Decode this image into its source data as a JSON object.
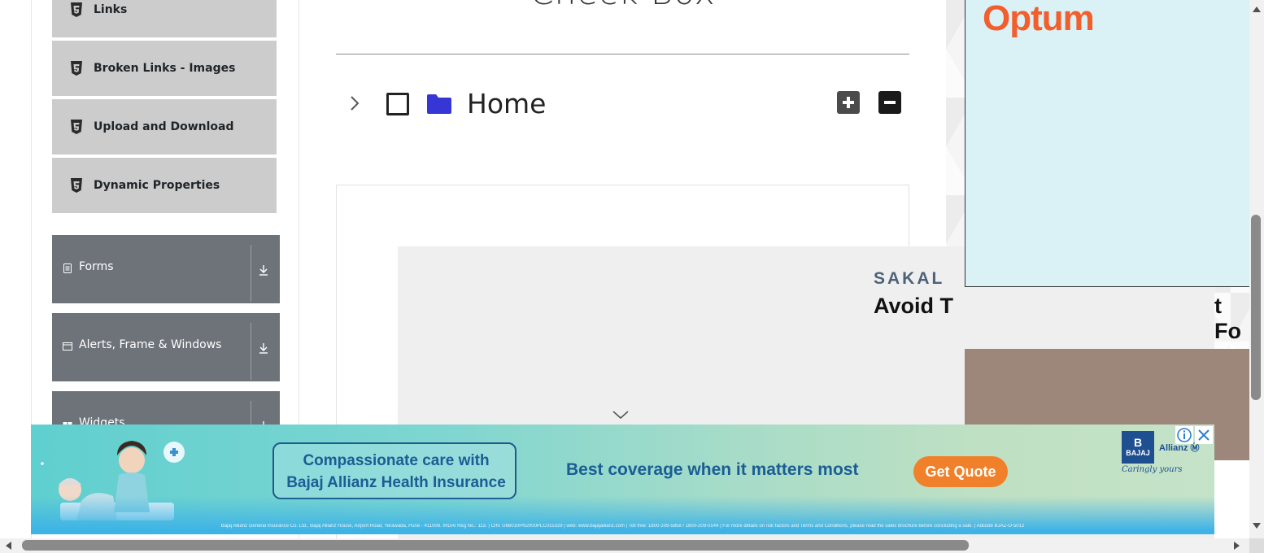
{
  "sidebar": {
    "elements_items": [
      {
        "label": "Links",
        "icon": "html5-icon"
      },
      {
        "label": "Broken Links - Images",
        "icon": "html5-icon"
      },
      {
        "label": "Upload and Download",
        "icon": "html5-icon"
      },
      {
        "label": "Dynamic Properties",
        "icon": "html5-icon"
      }
    ],
    "groups": [
      {
        "label": "Forms",
        "icon": "document-icon"
      },
      {
        "label": "Alerts, Frame & Windows",
        "icon": "window-icon"
      },
      {
        "label": "Widgets",
        "icon": "widgets-icon"
      }
    ]
  },
  "main": {
    "title": "Check Box",
    "tree": {
      "root_label": "Home",
      "expand_all_icon": "plus-square-icon",
      "collapse_all_icon": "minus-square-icon"
    }
  },
  "inner_ad": {
    "publisher": "SAKAL",
    "headline_left": "Avoid T",
    "headline_right": "t Fo"
  },
  "right_ad": {
    "brand": "Optum",
    "brand_color": "#f25e2c"
  },
  "banner": {
    "pill_line1": "Compassionate care with",
    "pill_line2": "Bajaj Allianz Health Insurance",
    "tagline": "Best coverage when it matters most",
    "cta": "Get Quote",
    "logo_mark": "B",
    "logo_mark_sub": "BAJAJ",
    "logo_text": "Allianz Ⓜ",
    "logo_sub": "Caringly yours",
    "fine_print": "Bajaj Allianz General Insurance Co. Ltd., Bajaj Allianz House, Airport Road, Yerawada, Pune - 411006. IRDAI Reg No.: 113. | CIN: U66010PN2000PLC015329 | web: www.bajajallianz.com | Toll free: 1800-209-5858 / 1800-209-0144 | For more details on risk factors and Terms and Conditions, please read the sales brochure before concluding a sale. | Adcode BJAZ-O-5012"
  }
}
